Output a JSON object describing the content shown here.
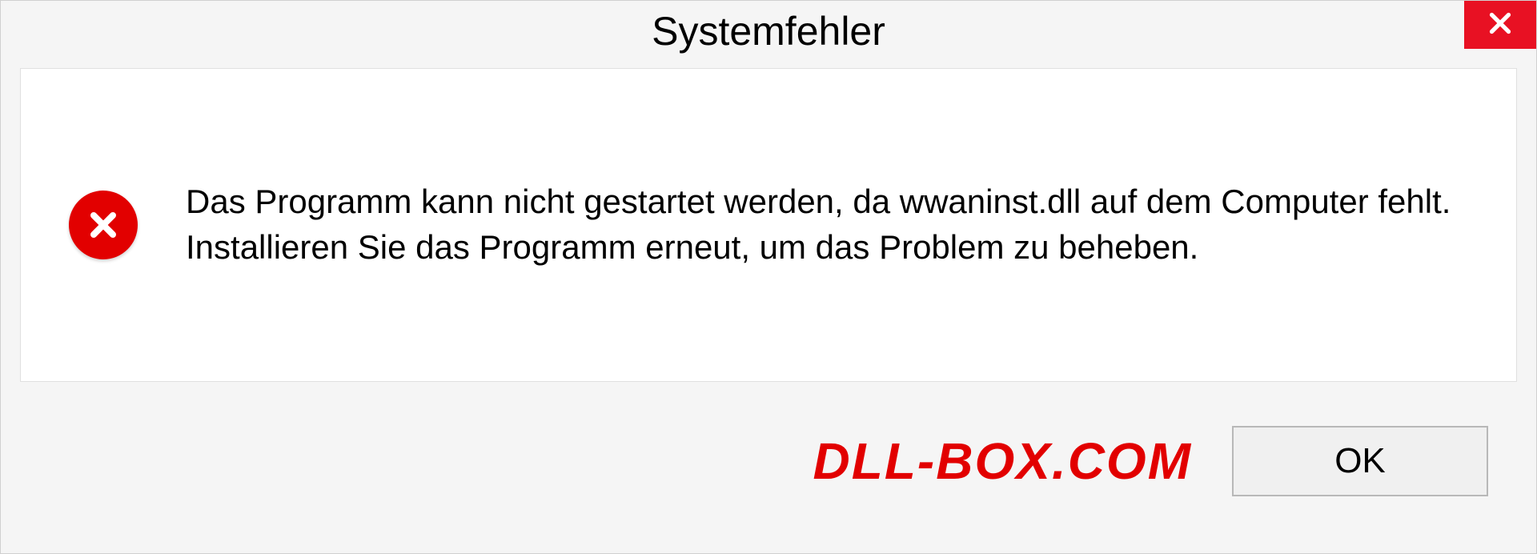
{
  "dialog": {
    "title": "Systemfehler",
    "message": "Das Programm kann nicht gestartet werden, da wwaninst.dll auf dem Computer fehlt. Installieren Sie das Programm erneut, um das Problem zu beheben.",
    "ok_label": "OK"
  },
  "watermark": "DLL-BOX.COM"
}
